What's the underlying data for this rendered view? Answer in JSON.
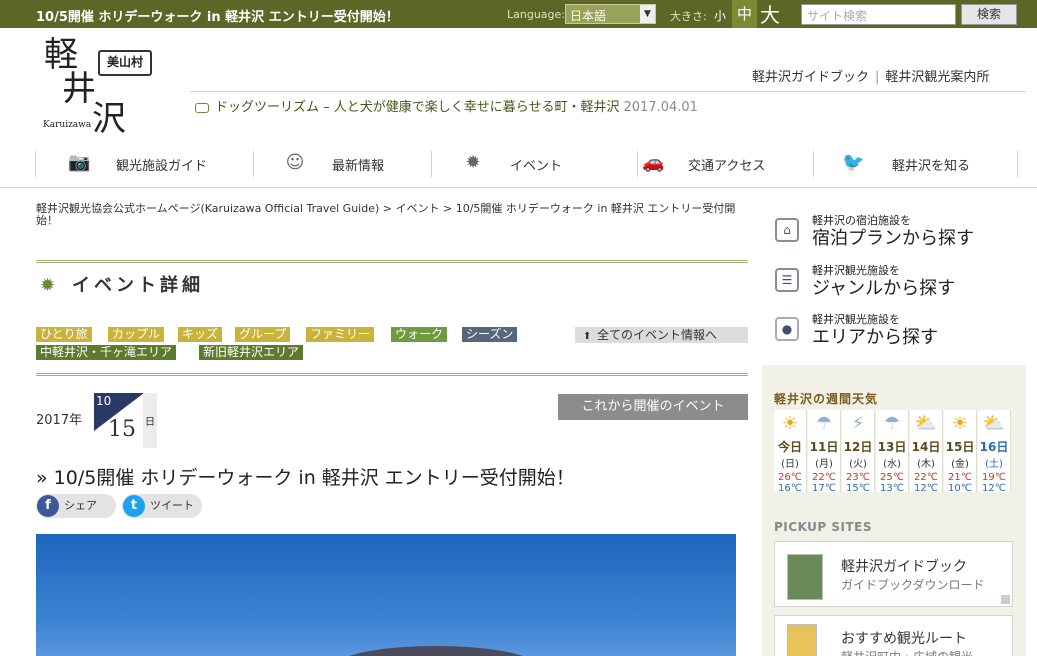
{
  "topbar": {
    "headline": "10/5開催 ホリデーウォーク in 軽井沢 エントリー受付開始！",
    "language_label": "Language:",
    "language_value": "日本語",
    "size_label": "大きさ:",
    "size_small": "小",
    "size_medium": "中",
    "size_large": "大",
    "search_placeholder": "サイト検索",
    "search_button": "検索"
  },
  "logo": {
    "kanji1": "軽",
    "kanji2": "井",
    "kanji3": "沢",
    "romaji": "Karuizawa",
    "stamp": "美山村"
  },
  "header_links": [
    "軽井沢ガイドブック",
    "軽井沢観光案内所"
  ],
  "header_sep": "|",
  "ticker": {
    "text": "ドッグツーリズム – 人と犬が健康で楽しく幸せに暮らせる町・軽井沢",
    "date": "2017.04.01"
  },
  "nav": [
    {
      "label": "観光施設ガイド",
      "icon": "camera-icon"
    },
    {
      "label": "最新情報",
      "icon": "person-icon"
    },
    {
      "label": "イベント",
      "icon": "event-icon"
    },
    {
      "label": "交通アクセス",
      "icon": "car-icon"
    },
    {
      "label": "軽井沢を知る",
      "icon": "bird-icon"
    }
  ],
  "breadcrumb": "軽井沢観光協会公式ホームページ(Karuizawa Official Travel Guide) > イベント > 10/5開催 ホリデーウォーク in 軽井沢 エントリー受付開始！",
  "section_title": "イベント詳細",
  "tags_row1": [
    {
      "label": "ひとり旅",
      "color": "yellow"
    },
    {
      "label": "カップル",
      "color": "yellow"
    },
    {
      "label": "キッズ",
      "color": "yellow"
    },
    {
      "label": "グループ",
      "color": "yellow"
    },
    {
      "label": "ファミリー",
      "color": "yellow"
    },
    {
      "label": "ウォーク",
      "color": "green"
    },
    {
      "label": "シーズン",
      "color": "slate"
    }
  ],
  "tags_row2": [
    {
      "label": "中軽井沢・千ヶ滝エリア",
      "color": "olive"
    },
    {
      "label": "新旧軽井沢エリア",
      "color": "olive"
    }
  ],
  "all_events_link": "全てのイベント情報へ",
  "event_date": {
    "year": "2017年",
    "month": "10",
    "day": "15",
    "day_suffix": "日"
  },
  "upcoming_button": "これから開催のイベント",
  "event_title": "» 10/5開催 ホリデーウォーク in 軽井沢 エントリー受付開始！",
  "share": {
    "facebook": "シェア",
    "twitter": "ツイート"
  },
  "side_search": [
    {
      "small": "軽井沢の宿泊施設を",
      "large": "宿泊プランから探す"
    },
    {
      "small": "軽井沢観光施設を",
      "large": "ジャンルから探す"
    },
    {
      "small": "軽井沢観光施設を",
      "large": "エリアから探す"
    }
  ],
  "weather": {
    "title": "軽井沢の週間天気",
    "days": [
      {
        "day": "今日",
        "weekday": "(日)",
        "high": "26℃",
        "low": "16℃",
        "icon": "sun"
      },
      {
        "day": "11日",
        "weekday": "(月)",
        "high": "22℃",
        "low": "17℃",
        "icon": "cloud-rain"
      },
      {
        "day": "12日",
        "weekday": "(火)",
        "high": "23℃",
        "low": "15℃",
        "icon": "cloud-thunder"
      },
      {
        "day": "13日",
        "weekday": "(水)",
        "high": "25℃",
        "low": "13℃",
        "icon": "cloud-rain"
      },
      {
        "day": "14日",
        "weekday": "(木)",
        "high": "22℃",
        "low": "12℃",
        "icon": "sun-cloud"
      },
      {
        "day": "15日",
        "weekday": "(金)",
        "high": "21℃",
        "low": "10℃",
        "icon": "sun"
      },
      {
        "day": "16日",
        "weekday": "(土)",
        "high": "19℃",
        "low": "12℃",
        "icon": "sun-cloud"
      }
    ]
  },
  "pickup": {
    "title": "PICKUP SITES",
    "cards": [
      {
        "title": "軽井沢ガイドブック",
        "sub": "ガイドブックダウンロード"
      },
      {
        "title": "おすすめ観光ルート",
        "sub": "軽井沢町内・広域の観光"
      }
    ]
  }
}
